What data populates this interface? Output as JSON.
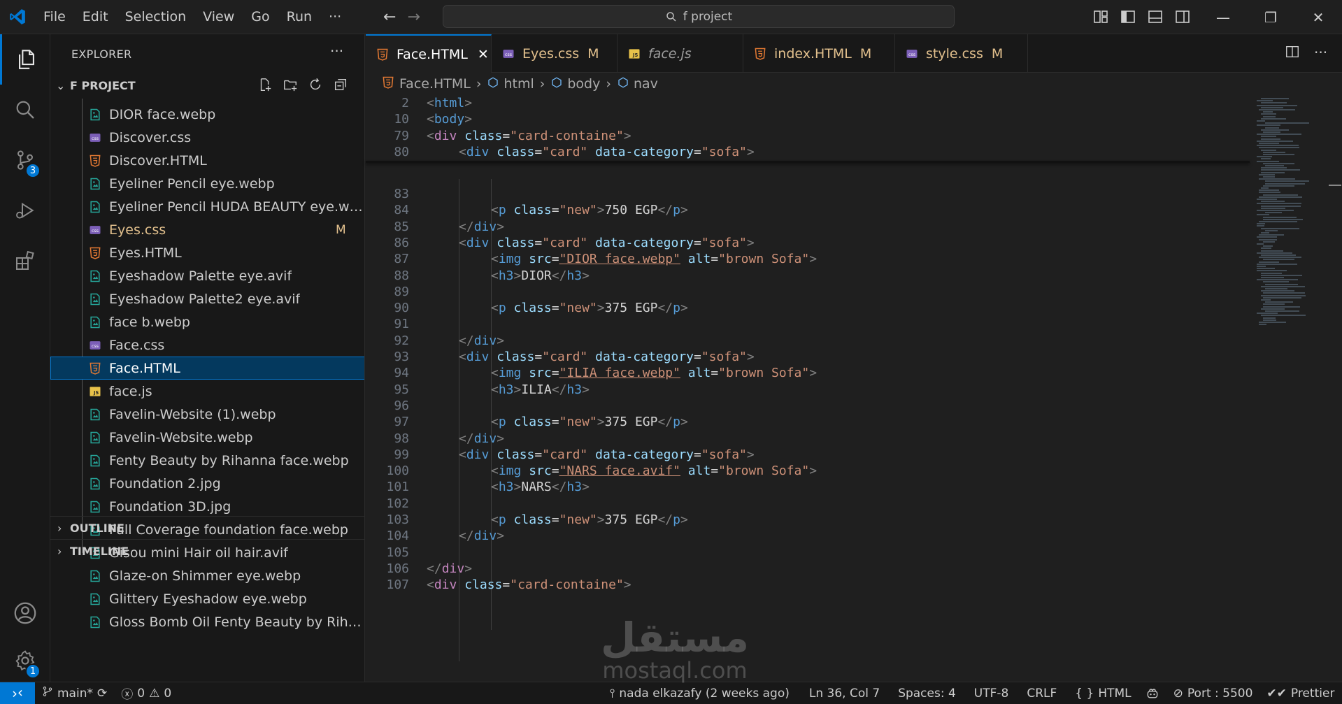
{
  "menu": {
    "items": [
      "File",
      "Edit",
      "Selection",
      "View",
      "Go",
      "Run",
      "···"
    ]
  },
  "command_center": {
    "text": "f project"
  },
  "activity": {
    "source_control_badge": "3",
    "settings_badge": "1"
  },
  "explorer": {
    "title": "EXPLORER",
    "more": "···",
    "folder_label": "F PROJECT",
    "outline_label": "OUTLINE",
    "timeline_label": "TIMELINE",
    "files": [
      {
        "name": "DIOR face.webp",
        "type": "image"
      },
      {
        "name": "Discover.css",
        "type": "css"
      },
      {
        "name": "Discover.HTML",
        "type": "html"
      },
      {
        "name": "Eyeliner Pencil eye.webp",
        "type": "image"
      },
      {
        "name": "Eyeliner Pencil HUDA BEAUTY eye.webp",
        "type": "image"
      },
      {
        "name": "Eyes.css",
        "type": "css",
        "badge": "M"
      },
      {
        "name": "Eyes.HTML",
        "type": "html"
      },
      {
        "name": "Eyeshadow Palette eye.avif",
        "type": "image"
      },
      {
        "name": "Eyeshadow Palette2 eye.avif",
        "type": "image"
      },
      {
        "name": "face b.webp",
        "type": "image"
      },
      {
        "name": "Face.css",
        "type": "css"
      },
      {
        "name": "Face.HTML",
        "type": "html",
        "selected": true
      },
      {
        "name": "face.js",
        "type": "js"
      },
      {
        "name": "Favelin-Website (1).webp",
        "type": "image"
      },
      {
        "name": "Favelin-Website.webp",
        "type": "image"
      },
      {
        "name": "Fenty Beauty by Rihanna face.webp",
        "type": "image"
      },
      {
        "name": "Foundation 2.jpg",
        "type": "image"
      },
      {
        "name": "Foundation 3D.jpg",
        "type": "image"
      },
      {
        "name": "Full Coverage foundation face.webp",
        "type": "image"
      },
      {
        "name": "Gisou mini Hair oil hair.avif",
        "type": "image"
      },
      {
        "name": "Glaze-on Shimmer eye.webp",
        "type": "image"
      },
      {
        "name": "Glittery Eyeshadow eye.webp",
        "type": "image"
      },
      {
        "name": "Gloss Bomb Oil Fenty Beauty by Rihanna...",
        "type": "image"
      }
    ]
  },
  "tabs": [
    {
      "label": "Face.HTML",
      "type": "html",
      "active": true,
      "close": "✕"
    },
    {
      "label": "Eyes.css",
      "type": "css",
      "mark": "M"
    },
    {
      "label": "face.js",
      "type": "js",
      "italic": true
    },
    {
      "label": "index.HTML",
      "type": "html",
      "mark": "M"
    },
    {
      "label": "style.css",
      "type": "css",
      "mark": "M"
    }
  ],
  "breadcrumb": [
    "Face.HTML",
    "html",
    "body",
    "nav"
  ],
  "code": {
    "sticky": [
      {
        "n": "2",
        "indent": 0,
        "tokens": [
          [
            "br",
            "<"
          ],
          [
            "tag",
            "html"
          ],
          [
            "br",
            ">"
          ]
        ]
      },
      {
        "n": "10",
        "indent": 0,
        "tokens": [
          [
            "br",
            "<"
          ],
          [
            "tag",
            "body"
          ],
          [
            "br",
            ">"
          ]
        ]
      },
      {
        "n": "79",
        "indent": 0,
        "tokens": [
          [
            "br",
            "<"
          ],
          [
            "pink",
            "div"
          ],
          [
            "text",
            " "
          ],
          [
            "attr",
            "class"
          ],
          [
            "punct",
            "="
          ],
          [
            "str",
            "\"card-containe\""
          ],
          [
            "br",
            ">"
          ]
        ]
      },
      {
        "n": "80",
        "indent": 1,
        "tokens": [
          [
            "br",
            "<"
          ],
          [
            "tag",
            "div"
          ],
          [
            "text",
            " "
          ],
          [
            "attr",
            "class"
          ],
          [
            "punct",
            "="
          ],
          [
            "str",
            "\"card\""
          ],
          [
            "text",
            " "
          ],
          [
            "attr",
            "data-category"
          ],
          [
            "punct",
            "="
          ],
          [
            "str",
            "\"sofa\""
          ],
          [
            "br",
            ">"
          ]
        ]
      }
    ],
    "lines": [
      {
        "n": "83",
        "indent": 0,
        "tokens": []
      },
      {
        "n": "84",
        "indent": 2,
        "tokens": [
          [
            "br",
            "<"
          ],
          [
            "tag",
            "p"
          ],
          [
            "text",
            " "
          ],
          [
            "attr",
            "class"
          ],
          [
            "punct",
            "="
          ],
          [
            "str",
            "\"new\""
          ],
          [
            "br",
            ">"
          ],
          [
            "text",
            "750 EGP"
          ],
          [
            "br",
            "</"
          ],
          [
            "tag",
            "p"
          ],
          [
            "br",
            ">"
          ]
        ]
      },
      {
        "n": "85",
        "indent": 1,
        "tokens": [
          [
            "br",
            "</"
          ],
          [
            "tag",
            "div"
          ],
          [
            "br",
            ">"
          ]
        ]
      },
      {
        "n": "86",
        "indent": 1,
        "tokens": [
          [
            "br",
            "<"
          ],
          [
            "tag",
            "div"
          ],
          [
            "text",
            " "
          ],
          [
            "attr",
            "class"
          ],
          [
            "punct",
            "="
          ],
          [
            "str",
            "\"card\""
          ],
          [
            "text",
            " "
          ],
          [
            "attr",
            "data-category"
          ],
          [
            "punct",
            "="
          ],
          [
            "str",
            "\"sofa\""
          ],
          [
            "br",
            ">"
          ]
        ]
      },
      {
        "n": "87",
        "indent": 2,
        "tokens": [
          [
            "br",
            "<"
          ],
          [
            "tag",
            "img"
          ],
          [
            "text",
            " "
          ],
          [
            "attr",
            "src"
          ],
          [
            "punct",
            "="
          ],
          [
            "strund",
            "\"DIOR face.webp\""
          ],
          [
            "text",
            " "
          ],
          [
            "attr",
            "alt"
          ],
          [
            "punct",
            "="
          ],
          [
            "str",
            "\"brown Sofa\""
          ],
          [
            "br",
            ">"
          ]
        ]
      },
      {
        "n": "88",
        "indent": 2,
        "tokens": [
          [
            "br",
            "<"
          ],
          [
            "tag",
            "h3"
          ],
          [
            "br",
            ">"
          ],
          [
            "text",
            "DIOR"
          ],
          [
            "br",
            "</"
          ],
          [
            "tag",
            "h3"
          ],
          [
            "br",
            ">"
          ]
        ]
      },
      {
        "n": "89",
        "indent": 0,
        "tokens": []
      },
      {
        "n": "90",
        "indent": 2,
        "tokens": [
          [
            "br",
            "<"
          ],
          [
            "tag",
            "p"
          ],
          [
            "text",
            " "
          ],
          [
            "attr",
            "class"
          ],
          [
            "punct",
            "="
          ],
          [
            "str",
            "\"new\""
          ],
          [
            "br",
            ">"
          ],
          [
            "text",
            "375 EGP"
          ],
          [
            "br",
            "</"
          ],
          [
            "tag",
            "p"
          ],
          [
            "br",
            ">"
          ]
        ]
      },
      {
        "n": "91",
        "indent": 0,
        "tokens": []
      },
      {
        "n": "92",
        "indent": 1,
        "tokens": [
          [
            "br",
            "</"
          ],
          [
            "tag",
            "div"
          ],
          [
            "br",
            ">"
          ]
        ]
      },
      {
        "n": "93",
        "indent": 1,
        "tokens": [
          [
            "br",
            "<"
          ],
          [
            "tag",
            "div"
          ],
          [
            "text",
            " "
          ],
          [
            "attr",
            "class"
          ],
          [
            "punct",
            "="
          ],
          [
            "str",
            "\"card\""
          ],
          [
            "text",
            " "
          ],
          [
            "attr",
            "data-category"
          ],
          [
            "punct",
            "="
          ],
          [
            "str",
            "\"sofa\""
          ],
          [
            "br",
            ">"
          ]
        ]
      },
      {
        "n": "94",
        "indent": 2,
        "tokens": [
          [
            "br",
            "<"
          ],
          [
            "tag",
            "img"
          ],
          [
            "text",
            " "
          ],
          [
            "attr",
            "src"
          ],
          [
            "punct",
            "="
          ],
          [
            "strund",
            "\"ILIA face.webp\""
          ],
          [
            "text",
            " "
          ],
          [
            "attr",
            "alt"
          ],
          [
            "punct",
            "="
          ],
          [
            "str",
            "\"brown Sofa\""
          ],
          [
            "br",
            ">"
          ]
        ]
      },
      {
        "n": "95",
        "indent": 2,
        "tokens": [
          [
            "br",
            "<"
          ],
          [
            "tag",
            "h3"
          ],
          [
            "br",
            ">"
          ],
          [
            "text",
            "ILIA"
          ],
          [
            "br",
            "</"
          ],
          [
            "tag",
            "h3"
          ],
          [
            "br",
            ">"
          ]
        ]
      },
      {
        "n": "96",
        "indent": 0,
        "tokens": []
      },
      {
        "n": "97",
        "indent": 2,
        "tokens": [
          [
            "br",
            "<"
          ],
          [
            "tag",
            "p"
          ],
          [
            "text",
            " "
          ],
          [
            "attr",
            "class"
          ],
          [
            "punct",
            "="
          ],
          [
            "str",
            "\"new\""
          ],
          [
            "br",
            ">"
          ],
          [
            "text",
            "375 EGP"
          ],
          [
            "br",
            "</"
          ],
          [
            "tag",
            "p"
          ],
          [
            "br",
            ">"
          ]
        ]
      },
      {
        "n": "98",
        "indent": 1,
        "tokens": [
          [
            "br",
            "</"
          ],
          [
            "tag",
            "div"
          ],
          [
            "br",
            ">"
          ]
        ]
      },
      {
        "n": "99",
        "indent": 1,
        "tokens": [
          [
            "br",
            "<"
          ],
          [
            "tag",
            "div"
          ],
          [
            "text",
            " "
          ],
          [
            "attr",
            "class"
          ],
          [
            "punct",
            "="
          ],
          [
            "str",
            "\"card\""
          ],
          [
            "text",
            " "
          ],
          [
            "attr",
            "data-category"
          ],
          [
            "punct",
            "="
          ],
          [
            "str",
            "\"sofa\""
          ],
          [
            "br",
            ">"
          ]
        ]
      },
      {
        "n": "100",
        "indent": 2,
        "tokens": [
          [
            "br",
            "<"
          ],
          [
            "tag",
            "img"
          ],
          [
            "text",
            " "
          ],
          [
            "attr",
            "src"
          ],
          [
            "punct",
            "="
          ],
          [
            "strund",
            "\"NARS face.avif\""
          ],
          [
            "text",
            " "
          ],
          [
            "attr",
            "alt"
          ],
          [
            "punct",
            "="
          ],
          [
            "str",
            "\"brown Sofa\""
          ],
          [
            "br",
            ">"
          ]
        ]
      },
      {
        "n": "101",
        "indent": 2,
        "tokens": [
          [
            "br",
            "<"
          ],
          [
            "tag",
            "h3"
          ],
          [
            "br",
            ">"
          ],
          [
            "text",
            "NARS"
          ],
          [
            "br",
            "</"
          ],
          [
            "tag",
            "h3"
          ],
          [
            "br",
            ">"
          ]
        ]
      },
      {
        "n": "102",
        "indent": 0,
        "tokens": []
      },
      {
        "n": "103",
        "indent": 2,
        "tokens": [
          [
            "br",
            "<"
          ],
          [
            "tag",
            "p"
          ],
          [
            "text",
            " "
          ],
          [
            "attr",
            "class"
          ],
          [
            "punct",
            "="
          ],
          [
            "str",
            "\"new\""
          ],
          [
            "br",
            ">"
          ],
          [
            "text",
            "375 EGP"
          ],
          [
            "br",
            "</"
          ],
          [
            "tag",
            "p"
          ],
          [
            "br",
            ">"
          ]
        ]
      },
      {
        "n": "104",
        "indent": 1,
        "tokens": [
          [
            "br",
            "</"
          ],
          [
            "tag",
            "div"
          ],
          [
            "br",
            ">"
          ]
        ]
      },
      {
        "n": "105",
        "indent": 0,
        "tokens": []
      },
      {
        "n": "106",
        "indent": 0,
        "tokens": [
          [
            "br",
            "</"
          ],
          [
            "pink",
            "div"
          ],
          [
            "br",
            ">"
          ]
        ]
      },
      {
        "n": "107",
        "indent": 0,
        "tokens": [
          [
            "br",
            "<"
          ],
          [
            "pink",
            "div"
          ],
          [
            "text",
            " "
          ],
          [
            "attr",
            "class"
          ],
          [
            "punct",
            "="
          ],
          [
            "str",
            "\"card-containe\""
          ],
          [
            "br",
            ">"
          ]
        ]
      }
    ]
  },
  "status": {
    "branch": "main*",
    "errors": "0",
    "warnings": "0",
    "blame": "nada elkazafy (2 weeks ago)",
    "position": "Ln 36, Col 7",
    "spaces": "Spaces: 4",
    "encoding": "UTF-8",
    "eol": "CRLF",
    "language": "HTML",
    "port": "Port : 5500",
    "formatter": "Prettier"
  },
  "watermark": {
    "arabic": "مستقل",
    "latin": "mostaql.com"
  },
  "colors": {
    "accent": "#0078d4",
    "html_icon": "#e37933",
    "css_icon": "#7c5fb8",
    "js_icon": "#e8c24a",
    "image_icon": "#26a69a",
    "modified": "#e2c08d"
  }
}
